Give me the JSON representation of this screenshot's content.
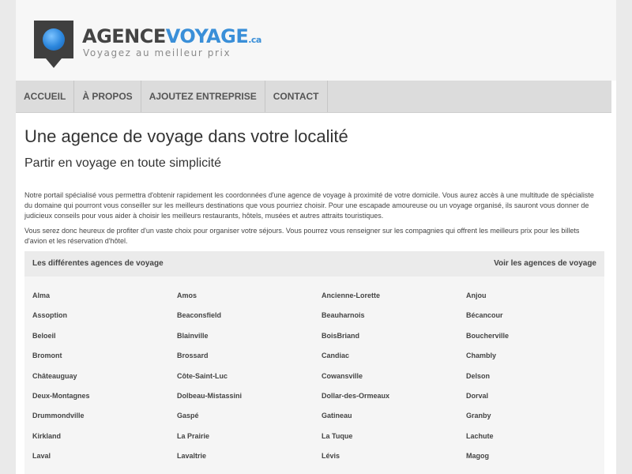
{
  "header": {
    "logo_part1": "AGENCE",
    "logo_part2": "VOYAGE",
    "logo_suffix": ".ca",
    "tagline": "Voyagez au meilleur prix"
  },
  "nav": {
    "items": [
      "ACCUEIL",
      "À PROPOS",
      "AJOUTEZ ENTREPRISE",
      "CONTACT"
    ]
  },
  "main": {
    "title": "Une agence de voyage dans votre localité",
    "subtitle": "Partir en voyage en toute simplicité",
    "paragraph1": "Notre portail spécialisé vous permettra d'obtenir rapidement les coordonnées d'une agence de voyage à proximité de votre domicile. Vous aurez accès à une multitude de spécialiste du domaine qui pourront vous conseiller sur les meilleurs destinations que vous pourriez choisir. Pour une escapade amoureuse ou un voyage organisé, ils sauront vous donner de judicieux conseils pour vous aider à choisir les meilleurs restaurants, hôtels, musées et autres attraits touristiques.",
    "paragraph2": "Vous serez donc heureux de profiter d'un vaste choix pour organiser votre séjours. Vous pourrez vous renseigner sur les compagnies qui offrent les meilleurs prix pour les billets d'avion et les réservation d'hôtel."
  },
  "agencies": {
    "heading": "Les différentes agences de voyage",
    "link": "Voir les agences de voyage",
    "cities": [
      [
        "Alma",
        "Amos",
        "Ancienne-Lorette",
        "Anjou"
      ],
      [
        "Assoption",
        "Beaconsfield",
        "Beauharnois",
        "Bécancour"
      ],
      [
        "Beloeil",
        "Blainville",
        "BoisBriand",
        "Boucherville"
      ],
      [
        "Bromont",
        "Brossard",
        "Candiac",
        "Chambly"
      ],
      [
        "Châteauguay",
        "Côte-Saint-Luc",
        "Cowansville",
        "Delson"
      ],
      [
        "Deux-Montagnes",
        "Dolbeau-Mistassini",
        "Dollar-des-Ormeaux",
        "Dorval"
      ],
      [
        "Drummondville",
        "Gaspé",
        "Gatineau",
        "Granby"
      ],
      [
        "Kirkland",
        "La Prairie",
        "La Tuque",
        "Lachute"
      ],
      [
        "Laval",
        "Lavaltrie",
        "Lévis",
        "Magog"
      ]
    ]
  }
}
